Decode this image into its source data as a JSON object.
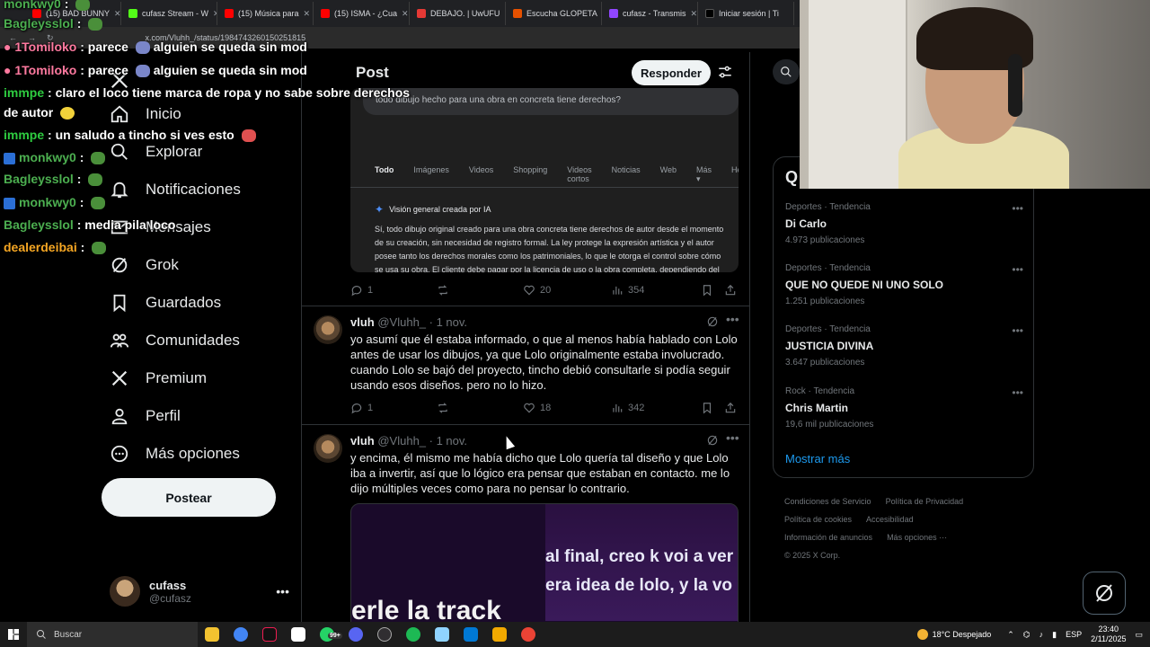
{
  "browser": {
    "tabs": [
      {
        "label": "(15) BAD BUNNY",
        "color": "#ff0000"
      },
      {
        "label": "cufasz Stream - W",
        "color": "#53fc18"
      },
      {
        "label": "(15) Música para",
        "color": "#ff0000"
      },
      {
        "label": "(15) ISMA - ¿Cua",
        "color": "#ff0000"
      },
      {
        "label": "DEBAJO. | UwUFU",
        "color": "#e53935"
      },
      {
        "label": "Escucha GLOPETA",
        "color": "#e65100"
      },
      {
        "label": "cufasz - Transmis",
        "color": "#9146ff"
      },
      {
        "label": "Iniciar sesión | Ti",
        "color": "#000000"
      }
    ],
    "url": "x.com/Vluhh_/status/1984743260150251815"
  },
  "chat": [
    {
      "user": "monkwy0",
      "color": "#4caf50",
      "message": ""
    },
    {
      "user": "Bagleysslol",
      "color": "#4caf50",
      "message": ""
    },
    {
      "user": "1Tomiloko",
      "color": "#ff7aa0",
      "message": "parece",
      "message2": "alguien se queda sin mod"
    },
    {
      "user": "1Tomiloko",
      "color": "#ff7aa0",
      "message": "parece",
      "message2": "alguien se queda sin mod"
    },
    {
      "user": "immpe",
      "color": "#2ecc40",
      "message": "claro el loco tiene marca de ropa y no sabe sobre derechos de autor"
    },
    {
      "user": "immpe",
      "color": "#2ecc40",
      "message": "un saludo a tincho si ves esto"
    },
    {
      "user": "monkwy0",
      "color": "#4caf50",
      "message": ""
    },
    {
      "user": "Bagleysslol",
      "color": "#4caf50",
      "message": ""
    },
    {
      "user": "monkwy0",
      "color": "#4caf50",
      "message": ""
    },
    {
      "user": "Bagleysslol",
      "color": "#4caf50",
      "message": "media pila loco"
    },
    {
      "user": "dealerdeibai",
      "color": "#f5a623",
      "message": ""
    }
  ],
  "nav": {
    "items": [
      "Inicio",
      "Explorar",
      "Notificaciones",
      "Mensajes",
      "Grok",
      "Guardados",
      "Comunidades",
      "Premium",
      "Perfil",
      "Más opciones"
    ],
    "post_label": "Postear",
    "profile_name": "cufass",
    "profile_handle": "@cufasz"
  },
  "main": {
    "title": "Post",
    "reply_label": "Responder",
    "embed": {
      "query": "todo dibujo hecho para una obra en concreta tiene derechos?",
      "tabs": [
        "Todo",
        "Imágenes",
        "Videos",
        "Shopping",
        "Videos cortos",
        "Noticias",
        "Web",
        "Más ▾",
        "Herramie"
      ],
      "ai_title": "Visión general creada por IA",
      "ai_text": "Sí, todo dibujo original creado para una obra concreta tiene derechos de autor desde el momento de su creación, sin necesidad de registro formal. La ley protege la expresión artística y el autor posee tanto los derechos morales como los patrimoniales, lo que le otorga el control sobre cómo se usa su obra. El cliente debe pagar por la licencia de uso o la obra completa, dependiendo del contrato, y no puede usar los bocetos si no son aprobados."
    },
    "actions1": {
      "replies": "1",
      "likes": "20",
      "views": "354"
    },
    "tweet1": {
      "name": "vluh",
      "handle": "@Vluhh_ · 1 nov.",
      "text": "yo asumí que él estaba informado, o que al menos había hablado con Lolo antes de usar los dibujos, ya que Lolo originalmente estaba involucrado. cuando Lolo se bajó del proyecto, tincho debió consultarle si podía seguir usando esos diseños. pero no lo hizo."
    },
    "actions2": {
      "replies": "1",
      "likes": "18",
      "views": "342"
    },
    "tweet2": {
      "name": "vluh",
      "handle": "@Vluhh_ · 1 nov.",
      "text": "y encima, él mismo me había dicho que Lolo quería tal diseño y que Lolo iba a invertir, así que lo lógico era pensar que estaban en contacto. me lo dijo múltiples veces como para no pensar lo contrario."
    },
    "video": {
      "line1": "al final, creo k voi a ver",
      "line2": "era idea de lolo, y la vo",
      "line3": "erle la track"
    }
  },
  "trends": {
    "header": "Q",
    "items": [
      {
        "category": "Deportes · Tendencia",
        "title": "Di Carlo",
        "posts": "4.973 publicaciones"
      },
      {
        "category": "Deportes · Tendencia",
        "title": "QUE NO QUEDE NI UNO SOLO",
        "posts": "1.251 publicaciones"
      },
      {
        "category": "Deportes · Tendencia",
        "title": "JUSTICIA DIVINA",
        "posts": "3.647 publicaciones"
      },
      {
        "category": "Rock · Tendencia",
        "title": "Chris Martin",
        "posts": "19,6 mil publicaciones"
      }
    ],
    "more": "Mostrar más"
  },
  "footer": {
    "links": [
      "Condiciones de Servicio",
      "Política de Privacidad",
      "Política de cookies",
      "Accesibilidad",
      "Información de anuncios",
      "Más opciones ···"
    ],
    "copyright": "© 2025 X Corp."
  },
  "taskbar": {
    "search_placeholder": "Buscar",
    "weather": "18°C  Despejado",
    "lang": "ESP",
    "time": "23:40",
    "date": "2/11/2025",
    "whatsapp_badge": "99+"
  }
}
